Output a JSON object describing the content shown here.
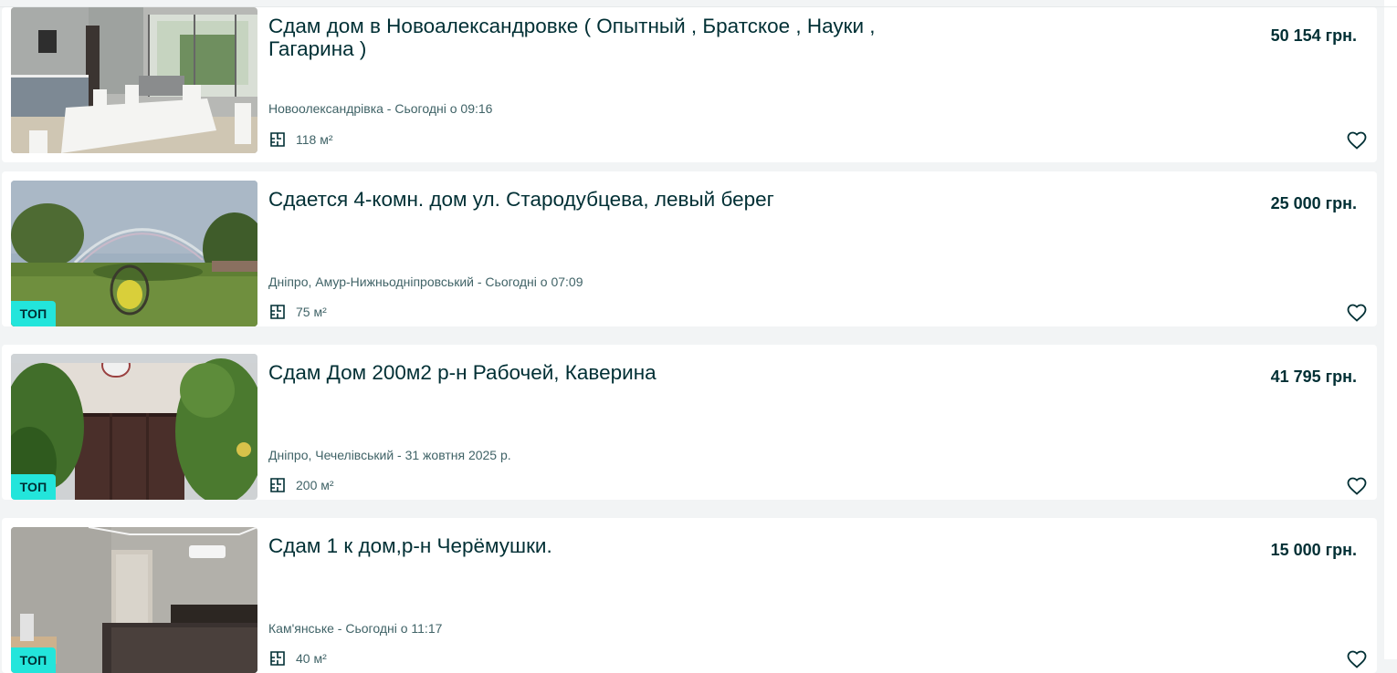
{
  "listings": [
    {
      "title": "Сдам дом в Новоалександровке ( Опытный , Братское , Науки , Гагарина )",
      "price": "50 154 грн.",
      "location_date": "Новоолександрівка - Сьогодні о 09:16",
      "area": "118 м²",
      "top": false,
      "image": "kitchen-dining-room-photo"
    },
    {
      "title": "Сдается 4-комн. дом ул. Стародубцева, левый берег",
      "price": "25 000 грн.",
      "location_date": "Дніпро, Амур-Нижньодніпровський - Сьогодні о 07:09",
      "area": "75 м²",
      "top": true,
      "top_label": "ТОП",
      "image": "garden-rainbow-photo"
    },
    {
      "title": "Сдам Дом 200м2 р-н Рабочей, Каверина",
      "price": "41 795 грн.",
      "location_date": "Дніпро, Чечелівський - 31 жовтня 2025 р.",
      "area": "200 м²",
      "top": true,
      "top_label": "ТОП",
      "image": "house-fence-garden-photo"
    },
    {
      "title": "Сдам 1 к дом,р-н Черёмушки.",
      "price": "15 000 грн.",
      "location_date": "Кам'янське - Сьогодні о 11:17",
      "area": "40 м²",
      "top": true,
      "top_label": "ТОП",
      "image": "bedroom-photo"
    }
  ],
  "icons": {
    "area": "area-plan-icon",
    "favorite": "heart-outline-icon"
  },
  "colors": {
    "text_primary": "#002f34",
    "text_secondary": "#406367",
    "top_badge": "#23e5db",
    "page_background": "#f2f4f5",
    "card_background": "#ffffff"
  }
}
